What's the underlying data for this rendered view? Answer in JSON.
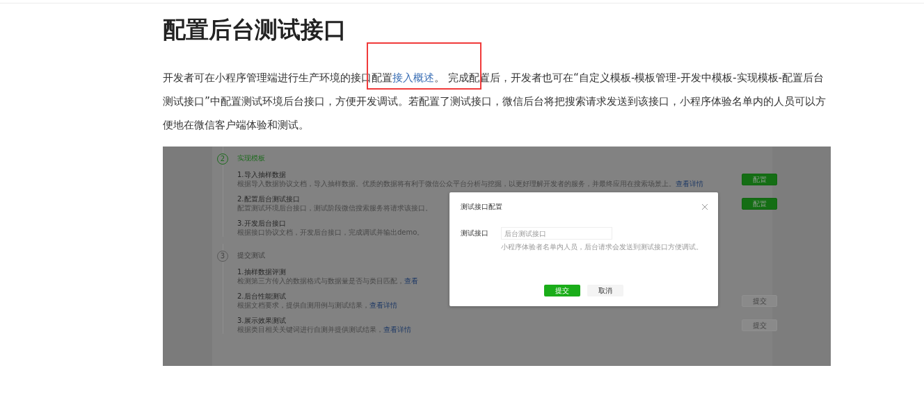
{
  "title": "配置后台测试接口",
  "intro": {
    "before": "开发者可在小程序管理端进行生产环境的接口配置",
    "link": "接入概述",
    "after": "。 完成配置后，开发者也可在“自定义模板-模板管理-开发中模板-实现模板-配置后台测试接口”中配置测试环境后台接口，方便开发调试。若配置了测试接口，微信后台将把搜索请求发送到该接口，小程序体验名单内的人员可以方便地在微信客户端体验和测试。"
  },
  "screenshot": {
    "sections": [
      {
        "number": "2",
        "title": "实现模板",
        "active": true,
        "steps": [
          {
            "title": "1.导入抽样数据",
            "desc": "根据导入数据协议文档，导入抽样数据。优质的数据将有利于微信公众平台分析与挖掘，以更好理解开发者的服务，并最终应用在搜索场景上。",
            "link": "查看详情",
            "button": {
              "label": "配置",
              "disabled": false
            }
          },
          {
            "title": "2.配置后台测试接口",
            "desc": "配置测试环境后台接口，测试阶段微信搜索服务将请求该接口。",
            "button": {
              "label": "配置",
              "disabled": false
            }
          },
          {
            "title": "3.开发后台接口",
            "desc": "根据接口协议文档，开发后台接口，完成调试并输出demo。"
          }
        ]
      },
      {
        "number": "3",
        "title": "提交测试",
        "active": false,
        "steps": [
          {
            "title": "1.抽样数据评测",
            "desc": "检测第三方传入的数据格式与数据量是否与类目匹配，",
            "link": "查看"
          },
          {
            "title": "2.后台性能测试",
            "desc": "根据文档要求，提供自测用例与测试结果，",
            "link": "查看详情",
            "button": {
              "label": "提交",
              "disabled": true
            }
          },
          {
            "title": "3.展示效果测试",
            "desc": "根据类目相关关键词进行自测并提供测试结果，",
            "link": "查看详情",
            "button": {
              "label": "提交",
              "disabled": true
            }
          }
        ]
      }
    ],
    "dialog": {
      "title": "测试接口配置",
      "field_label": "测试接口",
      "placeholder": "后台测试接口",
      "hint": "小程序体验者名单内人员，后台请求会发送到测试接口方便调试。",
      "buttons": [
        {
          "label": "提交",
          "kind": "primary"
        },
        {
          "label": "取消",
          "kind": "default"
        }
      ]
    }
  }
}
